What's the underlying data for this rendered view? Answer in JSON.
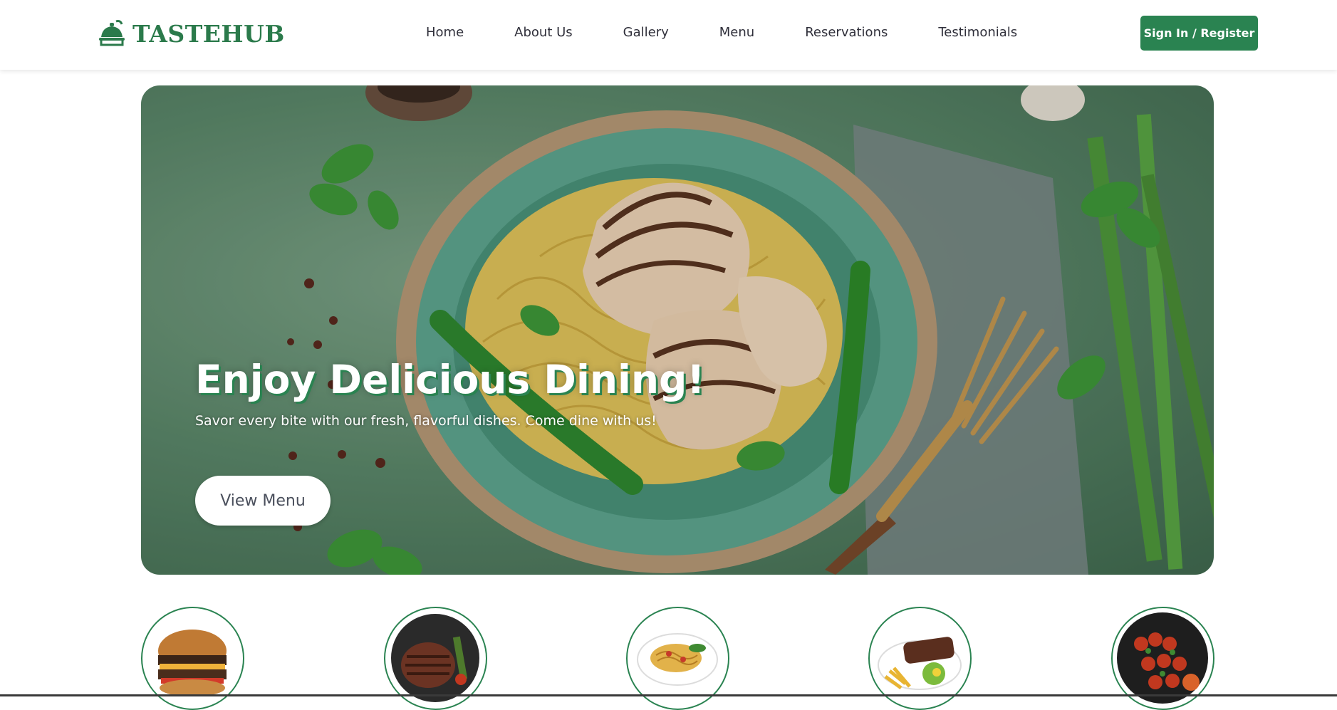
{
  "brand": {
    "name": "TASTEHUB",
    "icon": "plate-cloche-icon",
    "color": "#2b7a4b"
  },
  "nav": {
    "links": [
      "Home",
      "About Us",
      "Gallery",
      "Menu",
      "Reservations",
      "Testimonials"
    ],
    "signin_label": "Sign In / Register"
  },
  "hero": {
    "title": "Enjoy Delicious Dining!",
    "subtitle": "Savor every bite with our fresh, flavorful dishes. Come dine with us!",
    "button_label": "View Menu",
    "image": "grilled-chicken-noodles-photo"
  },
  "dishes": [
    {
      "name": "burger",
      "icon": "burger-icon"
    },
    {
      "name": "steak",
      "icon": "steak-icon"
    },
    {
      "name": "pasta",
      "icon": "pasta-icon"
    },
    {
      "name": "steak-fries",
      "icon": "steak-fries-icon"
    },
    {
      "name": "kebab",
      "icon": "kebab-icon"
    }
  ],
  "colors": {
    "accent": "#2a8351",
    "text": "#2f2f3a"
  }
}
